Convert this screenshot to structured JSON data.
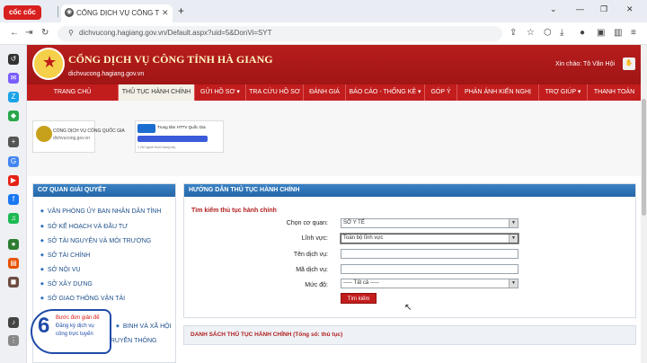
{
  "browser": {
    "brand": "cốc cốc",
    "tab_title": "CỔNG DỊCH VỤ CÔNG TỈNH",
    "new_tab": "+",
    "url": "dichvucong.hagiang.gov.vn/Default.aspx?uid=5&DonVi=SYT"
  },
  "site": {
    "title": "CỔNG DỊCH VỤ CÔNG TỈNH HÀ GIANG",
    "domain": "dichvucong.hagiang.gov.vn",
    "greeting": "Xin chào: Tô Văn Hội"
  },
  "nav": [
    {
      "label": "TRANG CHỦ"
    },
    {
      "label": "THỦ TỤC HÀNH CHÍNH"
    },
    {
      "label": "GỬI HỒ SƠ ▾"
    },
    {
      "label": "TRA CỨU HỒ SƠ"
    },
    {
      "label": "ĐÁNH GIÁ"
    },
    {
      "label": "BÁO CÁO - THỐNG KÊ ▾"
    },
    {
      "label": "GÓP Ý"
    },
    {
      "label": "PHẢN ÁNH KIẾN NGHỊ"
    },
    {
      "label": "TRỢ GIÚP ▾"
    },
    {
      "label": "THANH TOÁN"
    }
  ],
  "banners": {
    "national_portal": "CỔNG DỊCH VỤ CÔNG QUỐC GIA",
    "national_portal_url": "dichvucong.gov.vn",
    "hotline_title": "Trung tâm HTTV Quốc Gia",
    "hotline_note": "1.2M người thích trang này"
  },
  "left_panel": {
    "title": "CƠ QUAN GIẢI QUYẾT",
    "agencies": [
      "VĂN PHÒNG ỦY BAN NHÂN DÂN TỈNH",
      "SỞ KẾ HOẠCH VÀ ĐẦU TƯ",
      "SỞ TÀI NGUYÊN VÀ MÔI TRƯỜNG",
      "SỞ TÀI CHÍNH",
      "SỞ NỘI VỤ",
      "SỞ XÂY DỰNG",
      "SỞ GIAO THÔNG VẬN TẢI",
      "BINH VÀ XÃ HỘI",
      "RUYỀN THÔNG"
    ]
  },
  "main_panel": {
    "title": "HƯỚNG DẪN THỦ TỤC HÀNH CHÍNH",
    "search_title": "Tìm kiếm thủ tục hành chính",
    "form": {
      "agency_label": "Chọn cơ quan:",
      "agency_value": "SỞ Y TẾ",
      "field_label": "Lĩnh vực:",
      "field_value": "Toàn bộ lĩnh vực",
      "service_name_label": "Tên dịch vụ:",
      "service_name_value": "",
      "service_code_label": "Mã dịch vụ:",
      "service_code_value": "",
      "level_label": "Mức độ:",
      "level_value": "----- Tất cả -----",
      "search_button": "Tìm kiếm"
    },
    "list_title": "DANH SÁCH THỦ TỤC HÀNH CHÍNH   (Tổng số: thủ tục)"
  },
  "overlay": {
    "number": "6",
    "line1": "Bước đơn giản để",
    "line2": "Đăng ký dịch vụ",
    "line3": "công trực tuyến"
  },
  "colors": {
    "header_red": "#b81d1d",
    "panel_blue": "#2e74b8",
    "accent_red": "#c21d1d"
  }
}
